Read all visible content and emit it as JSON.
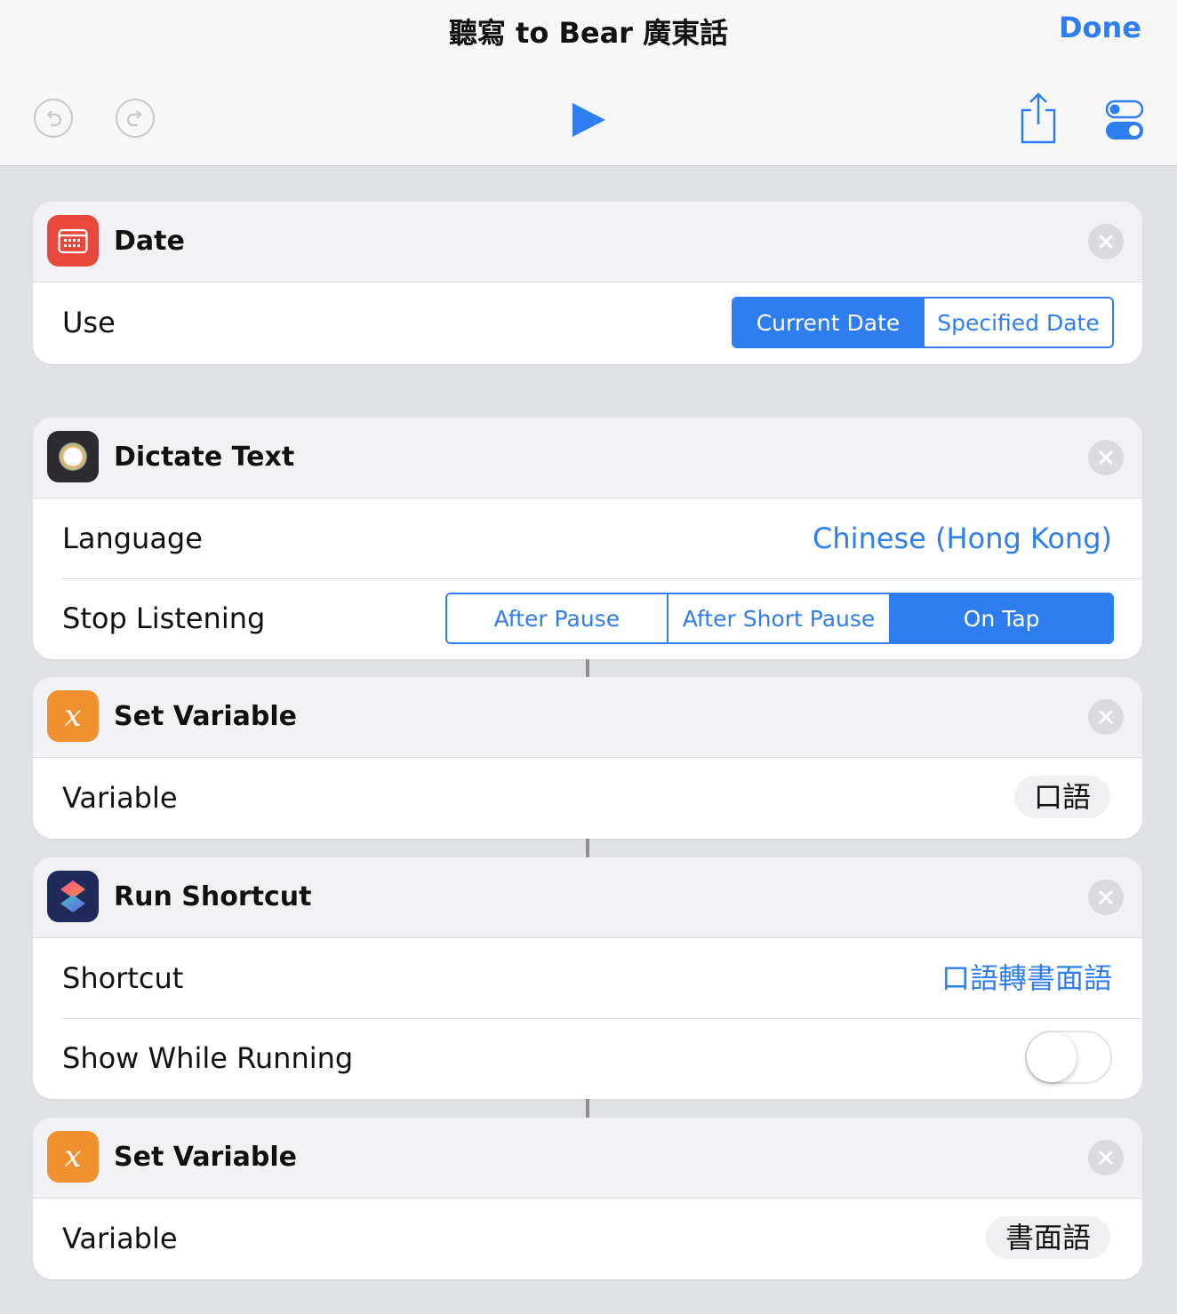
{
  "header": {
    "title": "聽寫 to Bear 廣東話",
    "done_label": "Done"
  },
  "toolbar": {
    "icons": [
      "undo-icon",
      "redo-icon",
      "play-icon",
      "share-icon",
      "settings-toggles-icon"
    ]
  },
  "actions": [
    {
      "title": "Date",
      "icon": "calendar-icon",
      "icon_color": "#e8483b",
      "rows": [
        {
          "label": "Use",
          "segments": [
            "Current Date",
            "Specified Date"
          ],
          "selected": "Current Date"
        }
      ]
    },
    {
      "title": "Dictate Text",
      "icon": "dictation-icon",
      "icon_color": "#2b2b30",
      "rows": [
        {
          "label": "Language",
          "value": "Chinese (Hong Kong)"
        },
        {
          "label": "Stop Listening",
          "segments": [
            "After Pause",
            "After Short Pause",
            "On Tap"
          ],
          "selected": "On Tap"
        }
      ]
    },
    {
      "title": "Set Variable",
      "icon": "variable-icon",
      "icon_color": "#f0902f",
      "rows": [
        {
          "label": "Variable",
          "token": "口語"
        }
      ]
    },
    {
      "title": "Run Shortcut",
      "icon": "shortcuts-icon",
      "icon_color": "#1f2a5a",
      "rows": [
        {
          "label": "Shortcut",
          "value": "口語轉書面語"
        },
        {
          "label": "Show While Running",
          "toggle": false
        }
      ]
    },
    {
      "title": "Set Variable",
      "icon": "variable-icon",
      "icon_color": "#f0902f",
      "rows": [
        {
          "label": "Variable",
          "token": "書面語"
        }
      ]
    }
  ],
  "colors": {
    "accent": "#2f7ef0",
    "background": "#e1e2e6"
  }
}
